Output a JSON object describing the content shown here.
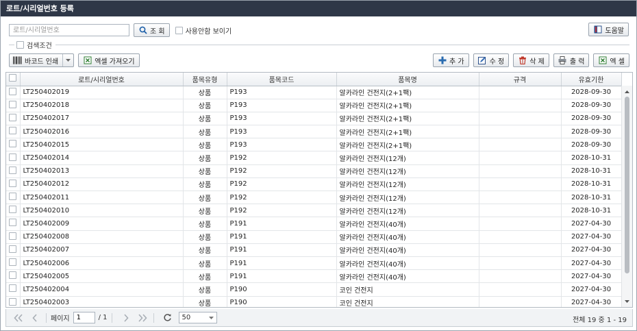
{
  "title": "로트/시리얼번호 등록",
  "search": {
    "placeholder": "로트/시리얼번호",
    "button": "조 회",
    "show_unused": "사용안함 보이기"
  },
  "help_label": "도움말",
  "condition_label": "검색조건",
  "toolbar": {
    "barcode_print": "바코드 인쇄",
    "excel_import": "엑셀 가져오기",
    "add": "추 가",
    "edit": "수 정",
    "delete": "삭 제",
    "print": "출 력",
    "excel": "엑 셀"
  },
  "columns": [
    "로트/시리얼번호",
    "품목유형",
    "품목코드",
    "품목명",
    "규격",
    "유효기한"
  ],
  "rows": [
    [
      "LT250402019",
      "상품",
      "P193",
      "알카라인 건전지(2+1팩)",
      "",
      "2028-09-30"
    ],
    [
      "LT250402018",
      "상품",
      "P193",
      "알카라인 건전지(2+1팩)",
      "",
      "2028-09-30"
    ],
    [
      "LT250402017",
      "상품",
      "P193",
      "알카라인 건전지(2+1팩)",
      "",
      "2028-09-30"
    ],
    [
      "LT250402016",
      "상품",
      "P193",
      "알카라인 건전지(2+1팩)",
      "",
      "2028-09-30"
    ],
    [
      "LT250402015",
      "상품",
      "P193",
      "알카라인 건전지(2+1팩)",
      "",
      "2028-09-30"
    ],
    [
      "LT250402014",
      "상품",
      "P192",
      "알카라인 건전지(12개)",
      "",
      "2028-10-31"
    ],
    [
      "LT250402013",
      "상품",
      "P192",
      "알카라인 건전지(12개)",
      "",
      "2028-10-31"
    ],
    [
      "LT250402012",
      "상품",
      "P192",
      "알카라인 건전지(12개)",
      "",
      "2028-10-31"
    ],
    [
      "LT250402011",
      "상품",
      "P192",
      "알카라인 건전지(12개)",
      "",
      "2028-10-31"
    ],
    [
      "LT250402010",
      "상품",
      "P192",
      "알카라인 건전지(12개)",
      "",
      "2028-10-31"
    ],
    [
      "LT250402009",
      "상품",
      "P191",
      "알카라인 건전지(40개)",
      "",
      "2027-04-30"
    ],
    [
      "LT250402008",
      "상품",
      "P191",
      "알카라인 건전지(40개)",
      "",
      "2027-04-30"
    ],
    [
      "LT250402007",
      "상품",
      "P191",
      "알카라인 건전지(40개)",
      "",
      "2027-04-30"
    ],
    [
      "LT250402006",
      "상품",
      "P191",
      "알카라인 건전지(40개)",
      "",
      "2027-04-30"
    ],
    [
      "LT250402005",
      "상품",
      "P191",
      "알카라인 건전지(40개)",
      "",
      "2027-04-30"
    ],
    [
      "LT250402004",
      "상품",
      "P190",
      "코인 건전지",
      "",
      "2027-04-30"
    ],
    [
      "LT250402003",
      "상품",
      "P190",
      "코인 건전지",
      "",
      "2027-04-30"
    ]
  ],
  "pager": {
    "page_label": "페이지",
    "page": "1",
    "total_pages": "/ 1",
    "page_size": "50",
    "summary": "전체 19 중 1 - 19"
  },
  "colors": {
    "titlebar": "#2e3747",
    "add_icon": "#2b6cb0",
    "delete_icon": "#c0392b",
    "excel_icon": "#2e7d32"
  },
  "icons": [
    "search-icon",
    "help-book-icon",
    "barcode-icon",
    "excel-icon",
    "plus-icon",
    "pencil-icon",
    "trash-icon",
    "printer-icon",
    "first-page-icon",
    "prev-page-icon",
    "next-page-icon",
    "last-page-icon",
    "refresh-icon"
  ]
}
